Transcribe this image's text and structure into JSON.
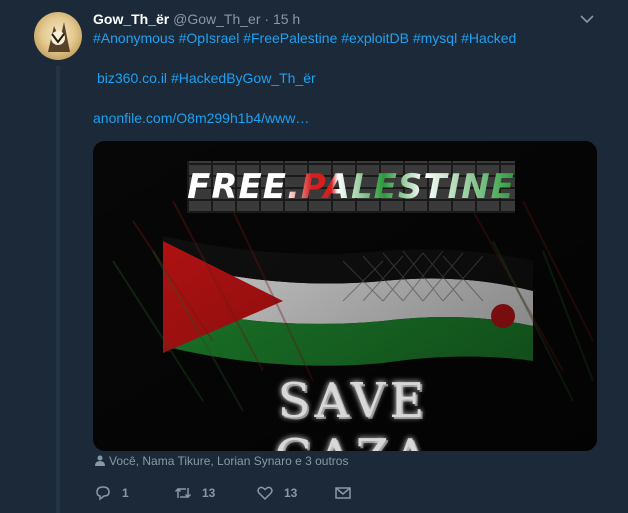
{
  "tweet": {
    "author_name": "Gow_Th_ër",
    "author_handle": "@Gow_Th_er",
    "separator": "·",
    "time": "15 h",
    "hashtags_line": "#Anonymous #OpIsrael #FreePalestine #exploitDB #mysql #Hacked",
    "site_text": "biz360.co.il",
    "hacked_by_tag": "#HackedByGow_Th_ër",
    "link_text": "anonfile.com/O8m299h1b4/www…",
    "media": {
      "banner_text": "FREE.PALESTINE",
      "caption_text": "SAVE GAZA"
    },
    "likers_text": "Você, Nama Tikure, Lorian Synaro e 3 outros"
  },
  "actions": {
    "reply_count": "1",
    "retweet_count": "13",
    "like_count": "13"
  },
  "icons": {
    "caret": "chevron-down-icon",
    "reply": "reply-icon",
    "retweet": "retweet-icon",
    "like": "heart-icon",
    "message": "envelope-icon",
    "person": "person-icon"
  },
  "colors": {
    "background": "#1c2938",
    "link": "#1da1f2",
    "muted": "#8899a6",
    "flag_red": "#d61e1e",
    "flag_green": "#2c9a3a"
  }
}
